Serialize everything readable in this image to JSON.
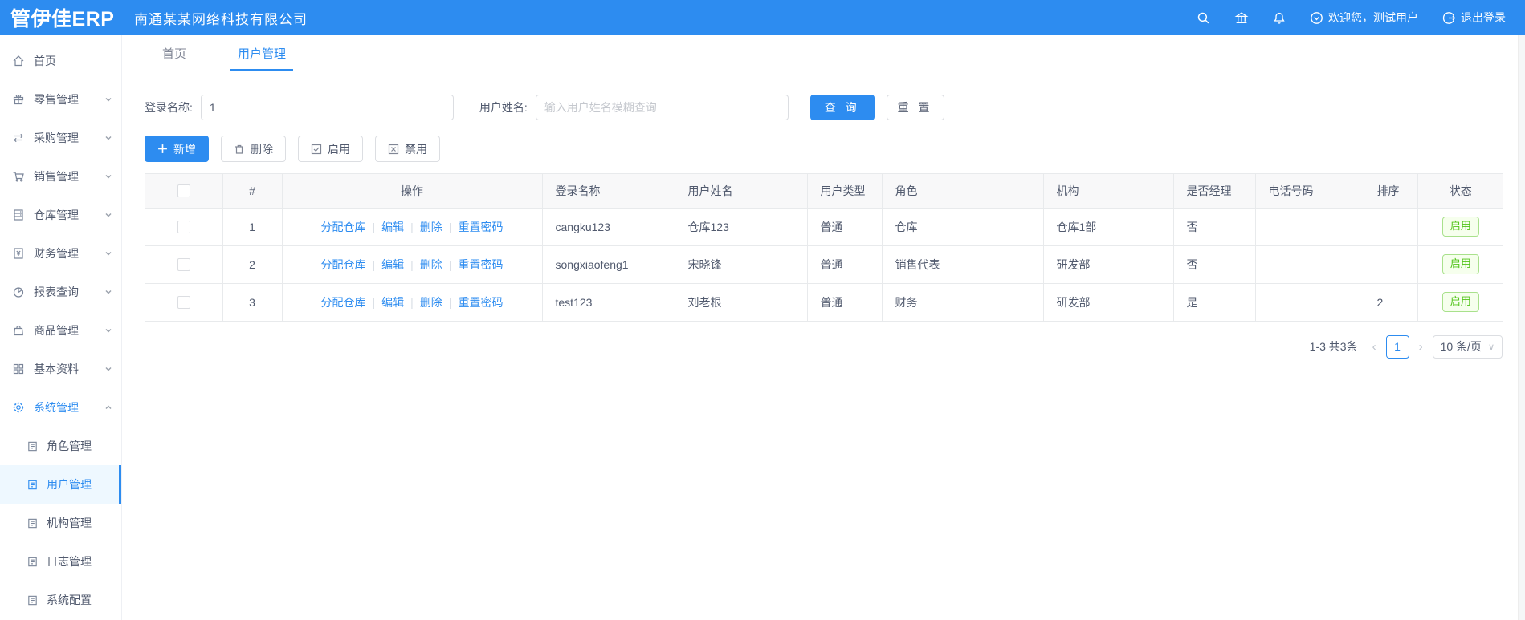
{
  "header": {
    "logo": "管伊佳ERP",
    "company": "南通某某网络科技有限公司",
    "welcome": "欢迎您，测试用户",
    "logout": "退出登录",
    "icons": [
      "search-icon",
      "bank-icon",
      "bell-icon",
      "user-circle-icon",
      "logout-icon"
    ]
  },
  "sidebar": {
    "items": [
      {
        "label": "首页",
        "icon": "home-icon",
        "expandable": false
      },
      {
        "label": "零售管理",
        "icon": "gift-icon",
        "expandable": true
      },
      {
        "label": "采购管理",
        "icon": "swap-icon",
        "expandable": true
      },
      {
        "label": "销售管理",
        "icon": "cart-icon",
        "expandable": true
      },
      {
        "label": "仓库管理",
        "icon": "warehouse-icon",
        "expandable": true
      },
      {
        "label": "财务管理",
        "icon": "finance-icon",
        "expandable": true
      },
      {
        "label": "报表查询",
        "icon": "pie-icon",
        "expandable": true
      },
      {
        "label": "商品管理",
        "icon": "bag-icon",
        "expandable": true
      },
      {
        "label": "基本资料",
        "icon": "grid-icon",
        "expandable": true
      },
      {
        "label": "系统管理",
        "icon": "gear-icon",
        "expandable": true,
        "expanded": true,
        "active": true
      }
    ],
    "submenu": [
      {
        "label": "角色管理",
        "active": false
      },
      {
        "label": "用户管理",
        "active": true
      },
      {
        "label": "机构管理",
        "active": false
      },
      {
        "label": "日志管理",
        "active": false
      },
      {
        "label": "系统配置",
        "active": false
      }
    ]
  },
  "tabs": [
    {
      "label": "首页",
      "active": false
    },
    {
      "label": "用户管理",
      "active": true
    }
  ],
  "search": {
    "login_label": "登录名称:",
    "login_value": "1",
    "name_label": "用户姓名:",
    "name_placeholder": "输入用户姓名模糊查询",
    "query_label": "查 询",
    "reset_label": "重 置"
  },
  "toolbar": {
    "add": "新增",
    "delete": "删除",
    "enable": "启用",
    "disable": "禁用"
  },
  "table": {
    "columns": [
      "#",
      "操作",
      "登录名称",
      "用户姓名",
      "用户类型",
      "角色",
      "机构",
      "是否经理",
      "电话号码",
      "排序",
      "状态"
    ],
    "row_actions": [
      "分配仓库",
      "编辑",
      "删除",
      "重置密码"
    ],
    "rows": [
      {
        "index": "1",
        "login": "cangku123",
        "name": "仓库123",
        "type": "普通",
        "role": "仓库",
        "org": "仓库1部",
        "manager": "否",
        "phone": "",
        "sort": "",
        "status": "启用"
      },
      {
        "index": "2",
        "login": "songxiaofeng1",
        "name": "宋晓锋",
        "type": "普通",
        "role": "销售代表",
        "org": "研发部",
        "manager": "否",
        "phone": "",
        "sort": "",
        "status": "启用"
      },
      {
        "index": "3",
        "login": "test123",
        "name": "刘老根",
        "type": "普通",
        "role": "财务",
        "org": "研发部",
        "manager": "是",
        "phone": "",
        "sort": "2",
        "status": "启用"
      }
    ]
  },
  "pagination": {
    "total_text": "1-3 共3条",
    "prev": "‹",
    "page": "1",
    "next": "›",
    "page_size": "10 条/页"
  },
  "colors": {
    "primary": "#2d8cf0",
    "success": "#52c41a",
    "header_bg": "#2d8cf0"
  }
}
